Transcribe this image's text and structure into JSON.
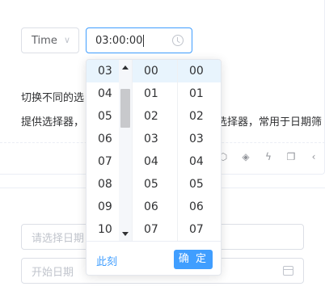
{
  "type_select": {
    "value": "Time",
    "chevron": "chevron-down-icon"
  },
  "time_input": {
    "value": "03:00:00",
    "icon": "clock-icon"
  },
  "description": {
    "line1": "切换不同的选",
    "line2": "提供选择器，",
    "line2_right": "选择器，常用于日期筛"
  },
  "toolbar": {
    "icons": [
      "cube-icon",
      "codepen-icon",
      "lightning-icon",
      "copy-icon",
      "chevron-left-icon"
    ],
    "glyphs": [
      "⬡",
      "◈",
      "ϟ",
      "❐",
      "‹"
    ]
  },
  "inputs": {
    "date_placeholder": "请选择日期",
    "start_placeholder": "开始日期"
  },
  "picker": {
    "hours": [
      "03",
      "04",
      "05",
      "06",
      "07",
      "08",
      "09",
      "10"
    ],
    "minutes": [
      "00",
      "01",
      "02",
      "03",
      "04",
      "05",
      "06",
      "07"
    ],
    "seconds": [
      "00",
      "01",
      "02",
      "03",
      "04",
      "05",
      "06",
      "07"
    ],
    "now_label": "此刻",
    "ok_label": "确 定"
  },
  "colors": {
    "accent": "#409eff",
    "active_row": "#e8f4fd"
  }
}
